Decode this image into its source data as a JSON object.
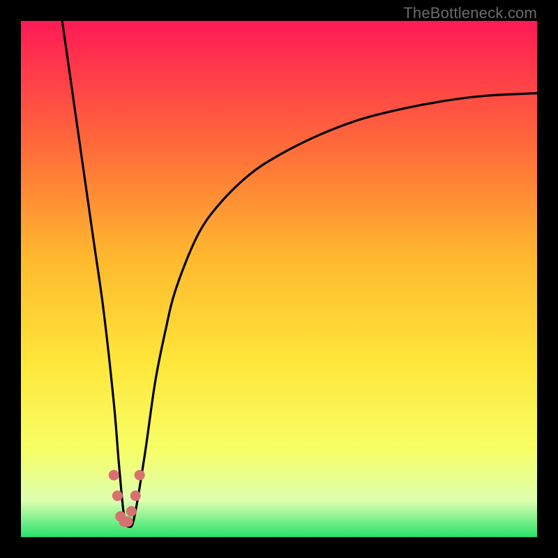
{
  "watermark": "TheBottleneck.com",
  "colors": {
    "bg": "#000000",
    "gradient_top": "#ff1a55",
    "gradient_upper_mid": "#ff6a3a",
    "gradient_mid": "#ffb92e",
    "gradient_lower_mid": "#ffe63a",
    "gradient_low": "#f7ff66",
    "gradient_pale": "#ddffb0",
    "gradient_bottom": "#26e26b",
    "curve": "#000000",
    "marker": "#d87070"
  },
  "chart_data": {
    "type": "line",
    "title": "",
    "xlabel": "",
    "ylabel": "",
    "xlim": [
      0,
      100
    ],
    "ylim": [
      0,
      100
    ],
    "series": [
      {
        "name": "bottleneck-curve",
        "x": [
          8,
          10,
          12,
          14,
          16,
          18,
          19,
          20,
          21,
          22,
          24,
          26,
          28,
          30,
          34,
          38,
          44,
          50,
          58,
          66,
          74,
          82,
          90,
          100
        ],
        "y": [
          100,
          86,
          72,
          58,
          44,
          26,
          14,
          4,
          2,
          4,
          16,
          30,
          40,
          48,
          58,
          64,
          70,
          74,
          78,
          81,
          83,
          84.5,
          85.5,
          86
        ]
      }
    ],
    "markers": {
      "name": "highlight-near-minimum",
      "x": [
        18.0,
        18.7,
        19.3,
        20.0,
        20.7,
        21.4,
        22.2,
        23.0
      ],
      "y": [
        12,
        8,
        4,
        3,
        3,
        5,
        8,
        12
      ]
    },
    "minimum": {
      "x": 20.5,
      "y": 2
    }
  }
}
